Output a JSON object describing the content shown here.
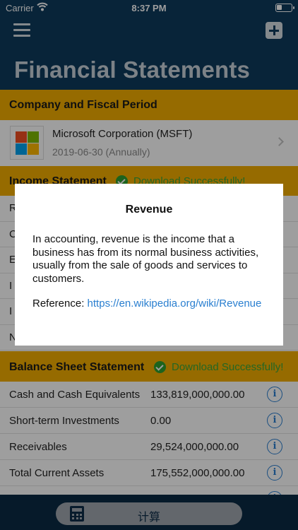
{
  "status_bar": {
    "carrier": "Carrier",
    "time": "8:37 PM",
    "battery_level": 0.35
  },
  "header": {
    "title": "Financial Statements"
  },
  "company_section": {
    "title": "Company and Fiscal Period",
    "company_name": "Microsoft Corporation (MSFT)",
    "period": "2019-06-30 (Annually)",
    "logo_colors": [
      "#f25022",
      "#7fba00",
      "#00a4ef",
      "#ffb900"
    ]
  },
  "income_section": {
    "title": "Income Statement",
    "status": "Download Successfully!",
    "row_initials": [
      "R",
      "C",
      "E",
      "I",
      "I",
      "N"
    ]
  },
  "balance_section": {
    "title": "Balance Sheet Statement",
    "status": "Download Successfully!",
    "rows": [
      {
        "name": "Cash and Cash Equivalents",
        "value": "133,819,000,000.00"
      },
      {
        "name": "Short-term Investments",
        "value": "0.00"
      },
      {
        "name": "Receivables",
        "value": "29,524,000,000.00"
      },
      {
        "name": "Total Current Assets",
        "value": "175,552,000,000.00"
      }
    ]
  },
  "dialog": {
    "title": "Revenue",
    "body": "In accounting, revenue is the income that a business has from its normal business activities, usually from the sale of goods and services to customers.",
    "reference_label": "Reference: ",
    "reference_link": "https://en.wikipedia.org/wiki/Revenue"
  },
  "bottom_bar": {
    "calculate_label": "计算"
  },
  "colors": {
    "nav": "#0e3a5c",
    "section_header": "#f2ad00",
    "success": "#2fa12f",
    "link": "#2a7fd0"
  }
}
